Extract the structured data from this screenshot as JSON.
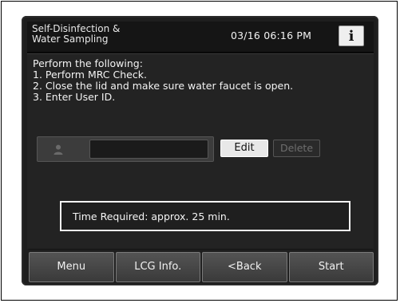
{
  "header": {
    "title": "Self-Disinfection &\nWater Sampling",
    "datetime": "03/16 06:16 PM",
    "info_icon": "i"
  },
  "instructions": [
    "Perform the following:",
    "1. Perform MRC Check.",
    "2. Close the lid and make sure water faucet is open.",
    "3. Enter User ID."
  ],
  "user_id": {
    "value": "",
    "icon": "user-icon"
  },
  "buttons": {
    "edit": "Edit",
    "delete": "Delete"
  },
  "time_required": "Time Required: approx. 25 min.",
  "footer": {
    "menu": "Menu",
    "lcg_info": "LCG Info.",
    "back": "<Back",
    "start": "Start"
  },
  "colors": {
    "screen_bg": "#232323",
    "disabled_text": "#6e6e6e"
  }
}
